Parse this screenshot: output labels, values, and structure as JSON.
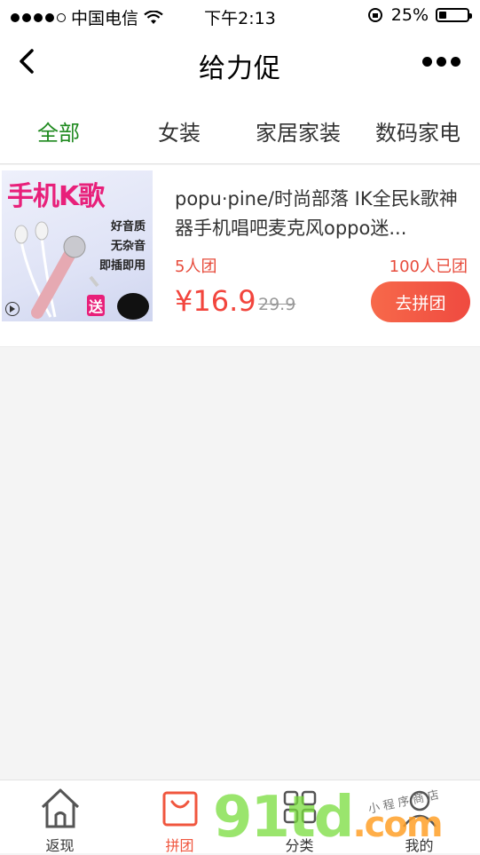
{
  "status_bar": {
    "carrier": "中国电信",
    "time": "下午2:13",
    "battery_percent": "25%",
    "battery_level": 0.25
  },
  "nav": {
    "title": "给力促"
  },
  "tabs": [
    {
      "label": "全部",
      "active": true
    },
    {
      "label": "女装",
      "active": false
    },
    {
      "label": "家居家装",
      "active": false
    },
    {
      "label": "数码家电",
      "active": false
    }
  ],
  "product": {
    "image_title": "手机K歌",
    "image_features": [
      "好音质",
      "无杂音",
      "即插即用"
    ],
    "image_gift": "送",
    "name": "popu·pine/时尚部落 IK全民k歌神器手机唱吧麦克风oppo迷...",
    "group_size": "5人团",
    "joined": "100人已团",
    "price": "¥16.9",
    "original_price": "29.9",
    "button": "去拼团"
  },
  "tabbar": [
    {
      "label": "返现",
      "icon": "home-icon",
      "active": false
    },
    {
      "label": "拼团",
      "icon": "shopping-bag-icon",
      "active": true
    },
    {
      "label": "分类",
      "icon": "grid-icon",
      "active": false
    },
    {
      "label": "我的",
      "icon": "user-icon",
      "active": false
    }
  ],
  "watermark": {
    "main": "91td",
    "suffix": ".com",
    "sub": "小程序商店"
  },
  "colors": {
    "active_tab": "#1f8a1f",
    "price": "#f2453d",
    "button": "#ef4a40",
    "tabbar_active": "#f0563e"
  }
}
